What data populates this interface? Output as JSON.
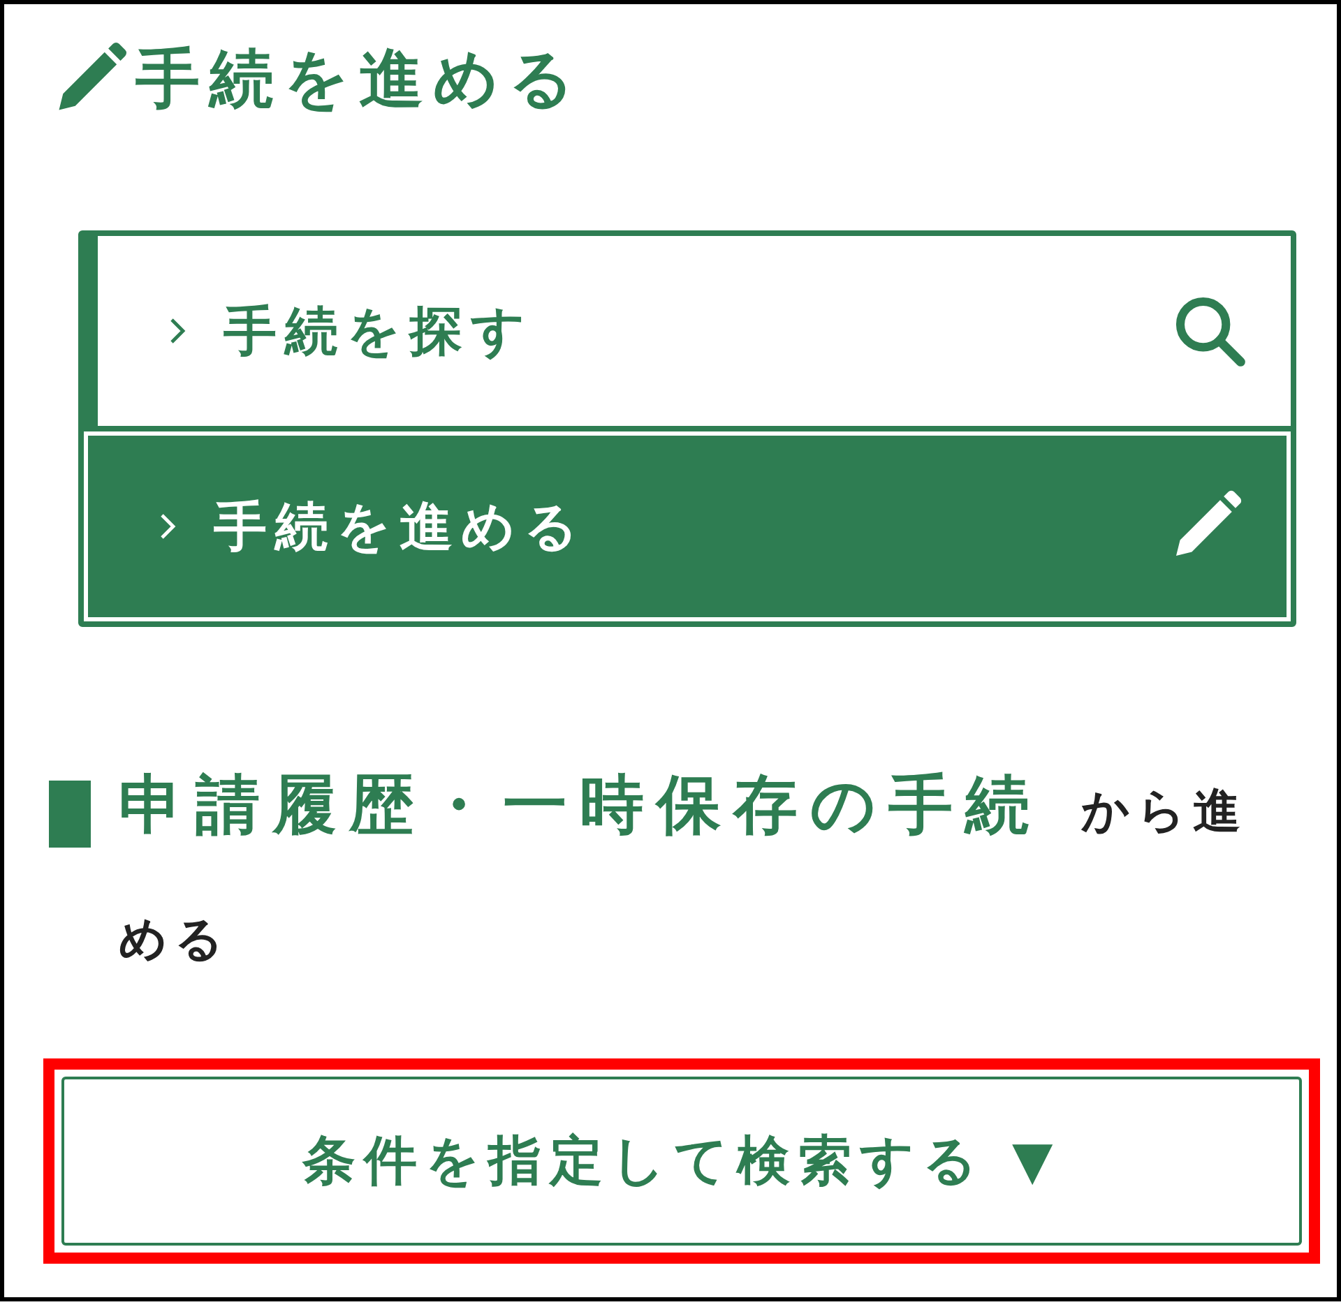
{
  "header": {
    "title": "手続を進める",
    "kind": "pencil"
  },
  "nav": [
    {
      "label": "手続を探す",
      "kind": "search",
      "selected": false
    },
    {
      "label": "手続を進める",
      "kind": "pencil",
      "selected": true
    }
  ],
  "section": {
    "title": "申請履歴・一時保存の手続",
    "suffix": "から進める"
  },
  "search_button": {
    "label": "条件を指定して検索する ▼",
    "highlighted": true
  }
}
